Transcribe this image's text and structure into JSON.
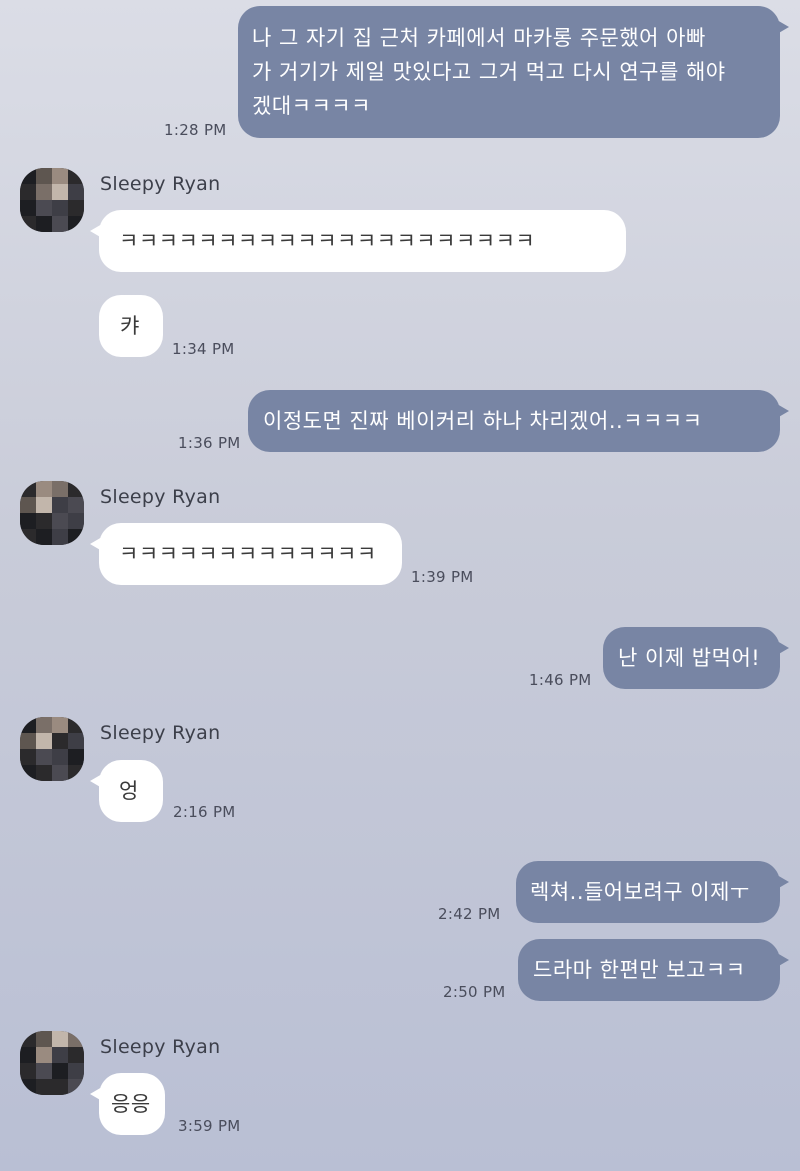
{
  "contact": {
    "name": "Sleepy Ryan"
  },
  "messages": [
    {
      "direction": "out",
      "lines": [
        "나 그 자기 집 근처 카페에서 마카롱 주문했어 아빠",
        "가 거기가 제일 맛있다고 그거 먹고 다시 연구를 해야",
        "겠대ㅋㅋㅋㅋ"
      ],
      "time": "1:28 PM"
    },
    {
      "direction": "in",
      "text": "ㅋㅋㅋㅋㅋㅋㅋㅋㅋㅋㅋㅋㅋㅋㅋㅋㅋㅋㅋㅋㅋ",
      "time": ""
    },
    {
      "direction": "in",
      "text": "캬",
      "time": "1:34 PM"
    },
    {
      "direction": "out",
      "text": "이정도면 진짜 베이커리 하나 차리겠어..ㅋㅋㅋㅋ",
      "time": "1:36 PM"
    },
    {
      "direction": "in",
      "text": "ㅋㅋㅋㅋㅋㅋㅋㅋㅋㅋㅋㅋㅋ",
      "time": "1:39 PM"
    },
    {
      "direction": "out",
      "text": "난 이제 밥먹어!",
      "time": "1:46 PM"
    },
    {
      "direction": "in",
      "text": "엉",
      "time": "2:16 PM"
    },
    {
      "direction": "out",
      "text": "렉쳐..들어보려구 이제ㅜ",
      "time": "2:42 PM"
    },
    {
      "direction": "out",
      "text": "드라마 한편만 보고ㅋㅋ",
      "time": "2:50 PM"
    },
    {
      "direction": "in",
      "text": "응응",
      "time": "3:59 PM"
    }
  ],
  "colors": {
    "outgoing_bubble": "#7885a4",
    "incoming_bubble": "#ffffff",
    "background_top": "#dbdde6",
    "background_bottom": "#b9bfd4"
  }
}
